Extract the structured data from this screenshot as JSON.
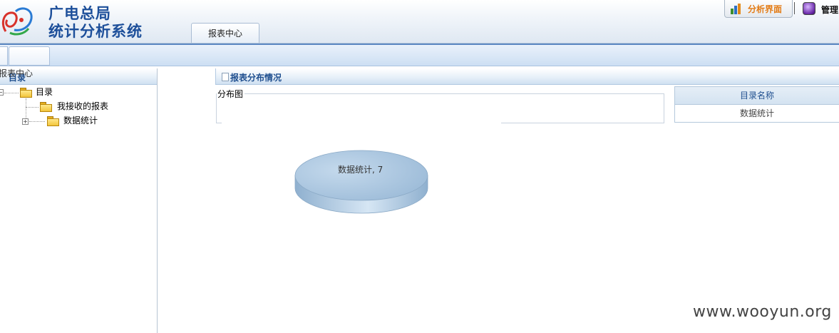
{
  "header": {
    "title_line1": "广电总局",
    "title_line2": "统计分析系统",
    "active_tab": "报表中心",
    "analysis_button": "分析界面",
    "manage_button": "管理"
  },
  "left_panel": {
    "overlap_text": "报表中心",
    "title": "目录",
    "tree": {
      "root": "目录",
      "children": [
        {
          "label": "我接收的报表"
        },
        {
          "label": "数据统计"
        }
      ]
    }
  },
  "main": {
    "title": "报表分布情况",
    "distribution_label": "分布图",
    "pie": {
      "label": "数据统计, 7",
      "color": "#a9c6e0"
    },
    "table": {
      "header": "目录名称",
      "rows": [
        "数据统计"
      ]
    }
  },
  "watermark": "www.wooyun.org"
}
